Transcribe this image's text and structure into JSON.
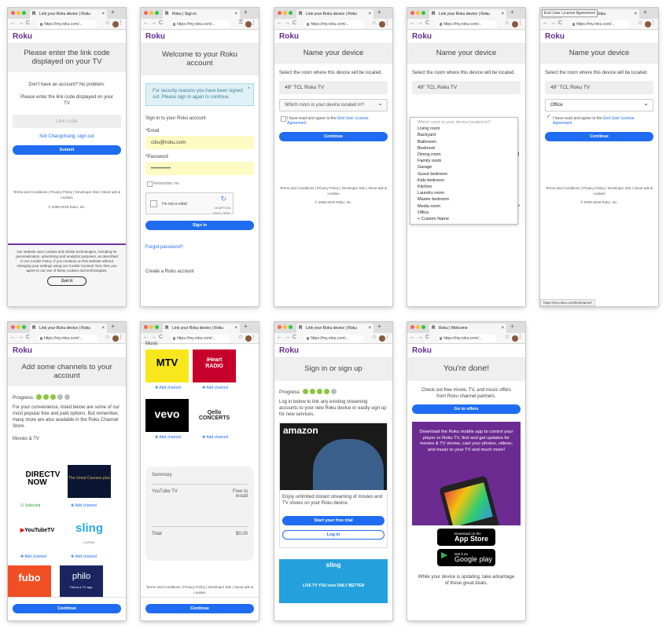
{
  "screens": [
    {
      "tab": "Link your Roku device | Roku",
      "url": "https://my.roku.com/...",
      "title": "Please enter the link code displayed on your TV",
      "no_account": "Don't have an account? No problem.",
      "instruction": "Please enter the link code displayed on your TV",
      "placeholder": "Link code",
      "signout": "Not Changchang, sign out",
      "submit": "Submit",
      "footer1": "Terms and Conditions | Privacy Policy | Developer Site | About ads & cookies",
      "copyright": "© 2008-2018 Roku, Inc.",
      "cookie": "Our website uses cookies and similar technologies, including for personalization, advertising and analytics purposes, as described in our Cookie Policy. If you continue on this website without changing your settings using our Cookie Consent Tool, then you agree to our use of these cookies and technologies.",
      "gotit": "Got it"
    },
    {
      "tab": "Roku | Sign in",
      "url": "https://my.roku.com/...",
      "title": "Welcome to your Roku account",
      "alert": "For security reasons you have been signed out. Please sign in again to continue.",
      "signin_lbl": "Sign in to your Roku account",
      "email_lbl": "*Email",
      "email_val": "ciliu@roku.com",
      "pw_lbl": "*Password",
      "pw_val": "•••••••••••",
      "remember": "Remember me",
      "captcha": "I'm not a robot",
      "recaptcha": "reCAPTCHA",
      "signin": "Sign in",
      "forgot": "Forgot password?",
      "create": "Create a Roku account"
    },
    {
      "tab": "Link your Roku device | Roku",
      "url": "https://my.roku.com/...",
      "title": "Name your device",
      "desc": "Select the room where this device will be located.",
      "device": "49\" TCL Roku TV",
      "room_ph": "Which room is your device located in?",
      "agree": "I have read and agree to the",
      "eula": "End User License Agreement",
      "cont": "Continue",
      "footer1": "Terms and Conditions | Privacy Policy | Developer Site | About ads & cookies",
      "copyright": "© 2008-2018 Roku, Inc."
    },
    {
      "tab": "Link your Roku device | Roku",
      "url": "https://my.roku.com/...",
      "title": "Name your device",
      "desc": "Select the room where this device will be located.",
      "device": "49\" TCL Roku TV",
      "rooms": [
        "Which room is your device located in?",
        "Living room",
        "Backyard",
        "Bathroom",
        "Bedroom",
        "Dining room",
        "Family room",
        "Garage",
        "Guest bedroom",
        "Kids bedroom",
        "Kitchen",
        "Laundry room",
        "Master bedroom",
        "Media room",
        "Office",
        "+ Custom Name"
      ],
      "footer1": "Terms and Conditions | Privacy Policy | Developer Site | About ads & cookies",
      "copyright": "© 2008-2018 Roku, Inc."
    },
    {
      "tab": "Roku device | Roku",
      "tooltip": "End User License Agreement",
      "url": "https://my.roku.com/...",
      "title": "Name your device",
      "desc": "Select the room where this device will be located.",
      "device": "49\" TCL Roku TV",
      "room_val": "Office",
      "agree": "I have read and agree to the",
      "eula": "End User License Agreement",
      "cont": "Continue",
      "footer1": "Terms and Conditions | Privacy Policy | Developer Site | About ads & cookies",
      "copyright": "© 2008-2018 Roku, Inc.",
      "status": "https://my.roku.com/link/name#"
    },
    {
      "tab": "Link your Roku device | Roku",
      "url": "https://my.roku.com/...",
      "title": "Add some channels to your account",
      "progress": "Progress",
      "desc": "For your convenience, listed below are some of our most popular free and paid options. But remember, many more are also available in the Roku Channel Store.",
      "section": "Movies & TV",
      "selected": "Selected",
      "add": "Add channel",
      "cont": "Continue",
      "ch1": "DIRECTV NOW",
      "ch2": "The Great Courses plus",
      "ch3": "YouTubeTV",
      "ch4": "sling",
      "ch4b": "LATINO",
      "ch5": "fubo",
      "ch6": "philo",
      "ch6b": "This is a TV app."
    },
    {
      "tab": "Link your Roku device | Roku",
      "url": "https://my.roku.com/...",
      "music": "Music",
      "add": "Add channel",
      "ch1": "MTV",
      "ch2": "iHeart RADIO",
      "ch3": "vevo",
      "ch4": "Qello CONCERTS",
      "summary": "Summary",
      "item": "YouTube TV",
      "item_price": "Free to install",
      "total": "Total",
      "total_val": "$0.00",
      "footer1": "Terms and Conditions | Privacy Policy | Developer Site | About ads & cookies",
      "copyright": "© 2008-2018 Roku, Inc.",
      "cont": "Continue"
    },
    {
      "tab": "Link your Roku device | Roku",
      "url": "https://my.roku.com/...",
      "title": "Sign in or sign up",
      "progress": "Progress",
      "desc": "Log in below to link any existing streaming accounts to your new Roku device or easily sign up for new services.",
      "amazon": "amazon",
      "amazon_desc": "Enjoy unlimited instant streaming of movies and TV shows on your Roku device.",
      "trial": "Start your free trial",
      "login": "Log in",
      "sling": "sling",
      "sling_tag": "LIVE TV YOU love ONLY BETTER"
    },
    {
      "tab": "Roku | Welcome",
      "url": "https://my.roku.com/...",
      "title": "You're done!",
      "desc": "Check out free movie, TV, and music offers from Roku channel partners.",
      "offers": "Go to offers",
      "promo": "Download the Roku mobile app to control your player or Roku TV, find and get updates for movies & TV shows, cast your photos, videos, and music to your TV and much more!",
      "appstore_top": "Download on the",
      "appstore": "App Store",
      "gplay_top": "Get it on",
      "gplay": "Google play",
      "bottom": "While your device is updating, take advantage of these great deals."
    }
  ],
  "common": {
    "logo": "Roku",
    "captcha_terms": "Privacy - Terms"
  }
}
